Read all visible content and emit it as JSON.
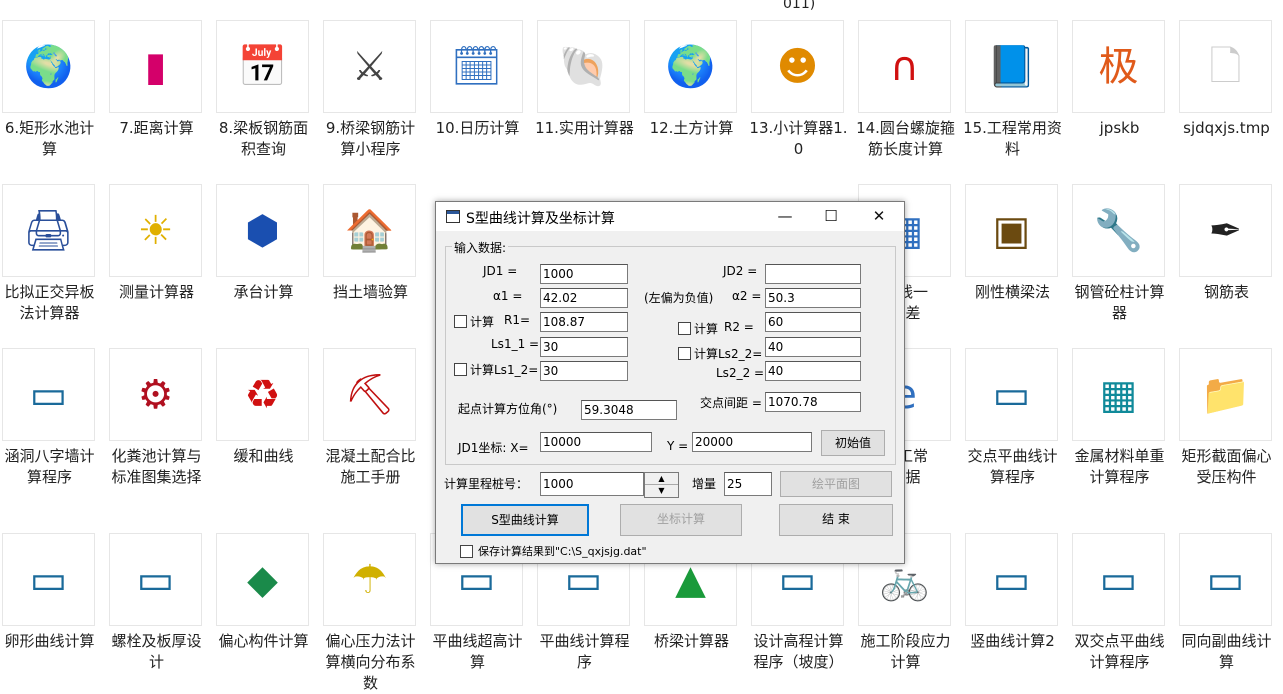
{
  "desktop": {
    "top_cut_text": "011)",
    "icons": [
      {
        "label": "6.矩形水池计算",
        "glyph": "🌍",
        "color": "#1a6fd1"
      },
      {
        "label": "7.距离计算",
        "glyph": "▮",
        "color": "#d4006a"
      },
      {
        "label": "8.梁板钢筋面积查询",
        "glyph": "📅",
        "color": "#444"
      },
      {
        "label": "9.桥梁钢筋计算小程序",
        "glyph": "⚔",
        "color": "#444"
      },
      {
        "label": "10.日历计算",
        "glyph": "🗓",
        "color": "#3070c0"
      },
      {
        "label": "11.实用计算器",
        "glyph": "🐚",
        "color": "#999"
      },
      {
        "label": "12.土方计算",
        "glyph": "🌍",
        "color": "#1a6fd1"
      },
      {
        "label": "13.小计算器1.0",
        "glyph": "☻",
        "color": "#e08a00"
      },
      {
        "label": "14.圆台螺旋箍筋长度计算",
        "glyph": "∩",
        "color": "#d01010"
      },
      {
        "label": "15.工程常用资料",
        "glyph": "📘",
        "color": "#3070c0"
      },
      {
        "label": "jpskb",
        "glyph": "极",
        "color": "#e05a1a"
      },
      {
        "label": "sjdqxjs.tmp",
        "glyph": "🗋",
        "color": "#cccccc"
      },
      {
        "label": "比拟正交异板法计算器",
        "glyph": "🖨",
        "color": "#2a4f9a"
      },
      {
        "label": "测量计算器",
        "glyph": "☀",
        "color": "#e0b000"
      },
      {
        "label": "承台计算",
        "glyph": "⬢",
        "color": "#1a4fb0"
      },
      {
        "label": "挡土墙验算",
        "glyph": "🏠",
        "color": "#c04010"
      },
      {
        "label": "导线一\n好差",
        "glyph": "▦",
        "color": "#3070c0"
      },
      {
        "label": "刚性横梁法",
        "glyph": "▣",
        "color": "#6b4a10"
      },
      {
        "label": "钢管砼柱计算器",
        "glyph": "🔧",
        "color": "#1a4fb0"
      },
      {
        "label": "钢筋表",
        "glyph": "✒",
        "color": "#222"
      },
      {
        "label": "涵洞八字墙计算程序",
        "glyph": "▭",
        "color": "#1a6a9a"
      },
      {
        "label": "化粪池计算与标准图集选择",
        "glyph": "⚙",
        "color": "#b01020"
      },
      {
        "label": "缓和曲线",
        "glyph": "♻",
        "color": "#d01010"
      },
      {
        "label": "混凝土配合比施工手册",
        "glyph": "⛏",
        "color": "#c01010"
      },
      {
        "label": "施工常\n数据",
        "glyph": "e",
        "color": "#3070c0"
      },
      {
        "label": "交点平曲线计算程序",
        "glyph": "▭",
        "color": "#1a6a9a"
      },
      {
        "label": "金属材料单重计算程序",
        "glyph": "▦",
        "color": "#108a9a"
      },
      {
        "label": "矩形截面偏心受压构件",
        "glyph": "📁",
        "color": "#3a5ad0"
      },
      {
        "label": "卵形曲线计算",
        "glyph": "▭",
        "color": "#1a6a9a"
      },
      {
        "label": "螺栓及板厚设计",
        "glyph": "▭",
        "color": "#1a6a9a"
      },
      {
        "label": "偏心构件计算",
        "glyph": "◆",
        "color": "#1a8a4a"
      },
      {
        "label": "偏心压力法计算横向分布系数",
        "glyph": "☂",
        "color": "#d0b000"
      },
      {
        "label": "平曲线超高计算",
        "glyph": "▭",
        "color": "#1a6a9a"
      },
      {
        "label": "平曲线计算程序",
        "glyph": "▭",
        "color": "#1a6a9a"
      },
      {
        "label": "桥梁计算器",
        "glyph": "▲",
        "color": "#1a9a3a"
      },
      {
        "label": "设计高程计算程序（坡度）",
        "glyph": "▭",
        "color": "#1a6a9a"
      },
      {
        "label": "施工阶段应力计算",
        "glyph": "🚲",
        "color": "#d01010"
      },
      {
        "label": "竖曲线计算2",
        "glyph": "▭",
        "color": "#1a6a9a"
      },
      {
        "label": "双交点平曲线计算程序",
        "glyph": "▭",
        "color": "#1a6a9a"
      },
      {
        "label": "同向副曲线计算",
        "glyph": "▭",
        "color": "#1a6a9a"
      }
    ]
  },
  "dialog": {
    "title": "S型曲线计算及坐标计算",
    "minimize": "—",
    "maximize": "☐",
    "close": "✕",
    "group_title": "输入数据:",
    "jd1_label": "JD1 =",
    "jd1_value": "1000",
    "jd2_label": "JD2 =",
    "jd2_value": "",
    "a1_label": "α1 =",
    "a1_value": "42.02",
    "note_label": "(左偏为负值)",
    "a2_label": "α2 =",
    "a2_value": "50.3",
    "r1_check_label": "计算",
    "r1_label": "R1=",
    "r1_value": "108.87",
    "r2_check_label": "计算",
    "r2_label": "R2 =",
    "r2_value": "60",
    "ls11_label": "Ls1_1 =",
    "ls11_value": "30",
    "ls22_check_label": "计算Ls2_2=",
    "ls22_value": "40",
    "ls12_check_label": "计算Ls1_2=",
    "ls12_value": "30",
    "ls22b_label": "Ls2_2 =",
    "ls22b_value": "40",
    "azimuth_label": "起点计算方位角(°)",
    "azimuth_value": "59.3048",
    "distance_label": "交点间距 =",
    "distance_value": "1070.78",
    "jd1coord_label": "JD1坐标:  X=",
    "x_value": "10000",
    "y_label": "Y =",
    "y_value": "20000",
    "init_button": "初始值",
    "station_label": "计算里程桩号：",
    "station_value": "1000",
    "increment_label": "增量",
    "increment_value": "25",
    "draw_button": "绘平面图",
    "s_curve_button": "S型曲线计算",
    "coord_button": "坐标计算",
    "end_button": "结 束",
    "save_label": "保存计算结果到\"C:\\S_qxjsjg.dat\""
  }
}
